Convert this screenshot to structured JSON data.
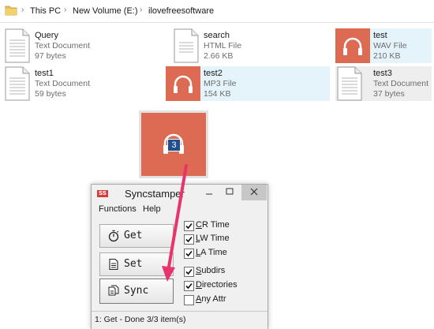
{
  "breadcrumb": {
    "items": [
      "This PC",
      "New Volume (E:)",
      "ilovefreesoftware"
    ]
  },
  "files": [
    {
      "name": "Query",
      "type": "Text Document",
      "size": "97 bytes",
      "icon": "text-doc-icon"
    },
    {
      "name": "search",
      "type": "HTML File",
      "size": "2.66 KB",
      "icon": "html-doc-icon"
    },
    {
      "name": "test",
      "type": "WAV File",
      "size": "210 KB",
      "icon": "headphones-icon"
    },
    {
      "name": "test1",
      "type": "Text Document",
      "size": "59 bytes",
      "icon": "text-doc-icon"
    },
    {
      "name": "test2",
      "type": "MP3 File",
      "size": "154 KB",
      "icon": "headphones-icon"
    },
    {
      "name": "test3",
      "type": "Text Document",
      "size": "37 bytes",
      "icon": "text-doc-icon"
    }
  ],
  "drag": {
    "count_badge": "3",
    "icon": "headphones-icon"
  },
  "app": {
    "icon_text": "SS",
    "title": "Syncstamper",
    "menu": [
      "Functions",
      "Help"
    ],
    "buttons": [
      {
        "label": "Get",
        "icon": "stopwatch-icon"
      },
      {
        "label": "Set",
        "icon": "document-icon"
      },
      {
        "label": "Sync",
        "icon": "copy-icon"
      }
    ],
    "checkboxes": [
      {
        "key": "C",
        "rest": "R Time",
        "checked": true
      },
      {
        "key": "L",
        "rest": "W Time",
        "checked": true
      },
      {
        "key": "L",
        "rest": "A Time",
        "checked": true
      },
      {
        "key": "S",
        "rest": "ubdirs",
        "checked": true
      },
      {
        "key": "D",
        "rest": "irectories",
        "checked": true
      },
      {
        "key": "A",
        "rest": "ny Attr",
        "checked": false
      }
    ],
    "status": "1: Get - Done 3/3 item(s)"
  },
  "colors": {
    "audio_tile": "#dd6a52",
    "selection": "#e5f3fb",
    "arrow": "#e8336c",
    "badge": "#1f4f8f"
  }
}
